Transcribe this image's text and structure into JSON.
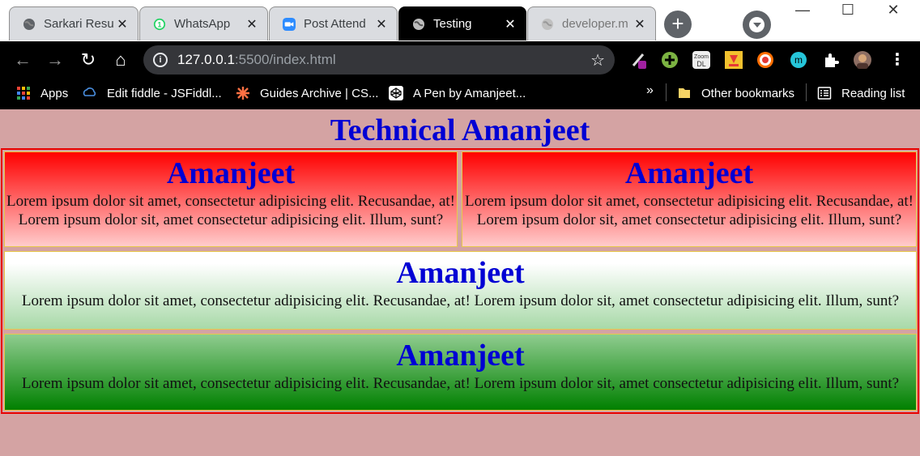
{
  "tabs": [
    {
      "title": "Sarkari Resu",
      "icon": "globe-icon",
      "active": false
    },
    {
      "title": "WhatsApp",
      "icon": "whatsapp-icon",
      "active": false,
      "badge": "1"
    },
    {
      "title": "Post Attend",
      "icon": "zoom-icon",
      "active": false
    },
    {
      "title": "Testing",
      "icon": "globe-icon",
      "active": true
    },
    {
      "title": "developer.m",
      "icon": "globe-icon",
      "active": false
    }
  ],
  "toolbar": {
    "url_host": "127.0.0.1",
    "url_rest": ":5500/index.html"
  },
  "bookmarks": [
    {
      "label": "Apps",
      "icon": "apps-grid-icon"
    },
    {
      "label": "Edit fiddle - JSFiddl...",
      "icon": "jsfiddle-icon"
    },
    {
      "label": "Guides Archive | CS...",
      "icon": "css-tricks-icon"
    },
    {
      "label": "A Pen by Amanjeet...",
      "icon": "codepen-icon"
    }
  ],
  "bookmarks_right": [
    {
      "label": "Other bookmarks",
      "icon": "folder-icon"
    },
    {
      "label": "Reading list",
      "icon": "reading-list-icon"
    }
  ],
  "extensions": {
    "zoom_badge": "Zoom DL"
  },
  "page": {
    "title": "Technical Amanjeet",
    "cards": [
      {
        "heading": "Amanjeet",
        "text": "Lorem ipsum dolor sit amet, consectetur adipisicing elit. Recusandae, at! Lorem ipsum dolor sit, amet consectetur adipisicing elit. Illum, sunt?"
      },
      {
        "heading": "Amanjeet",
        "text": "Lorem ipsum dolor sit amet, consectetur adipisicing elit. Recusandae, at! Lorem ipsum dolor sit, amet consectetur adipisicing elit. Illum, sunt?"
      },
      {
        "heading": "Amanjeet",
        "text": "Lorem ipsum dolor sit amet, consectetur adipisicing elit. Recusandae, at! Lorem ipsum dolor sit, amet consectetur adipisicing elit. Illum, sunt?"
      },
      {
        "heading": "Amanjeet",
        "text": "Lorem ipsum dolor sit amet, consectetur adipisicing elit. Recusandae, at! Lorem ipsum dolor sit, amet consectetur adipisicing elit. Illum, sunt?"
      }
    ]
  },
  "colors": {
    "page_bg": "#d4a3a3",
    "heading": "#0000d4",
    "container_border": "#e80000",
    "card_border": "#e8c94a"
  }
}
